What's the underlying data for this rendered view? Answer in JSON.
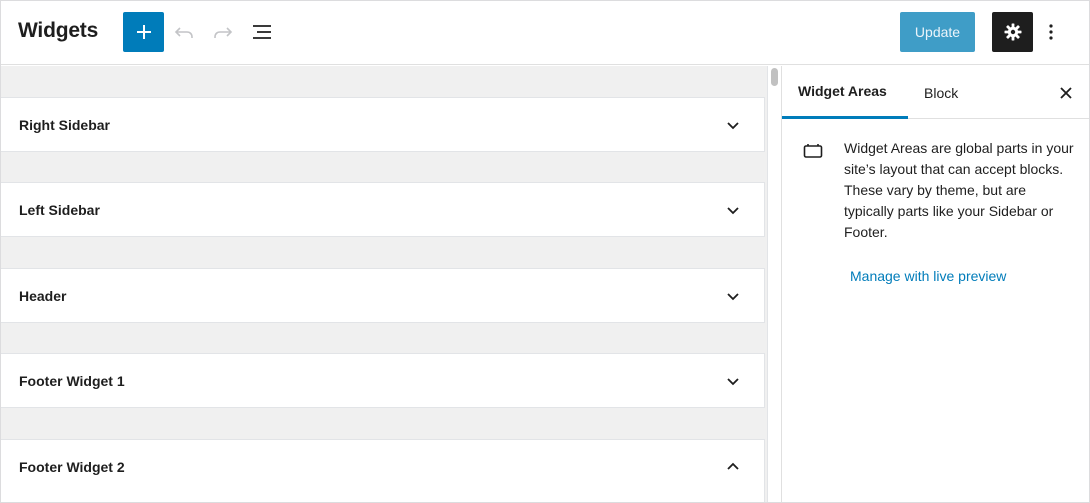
{
  "header": {
    "title": "Widgets",
    "update_label": "Update"
  },
  "widget_areas": [
    {
      "label": "Right Sidebar",
      "expanded": false
    },
    {
      "label": "Left Sidebar",
      "expanded": false
    },
    {
      "label": "Header",
      "expanded": false
    },
    {
      "label": "Footer Widget 1",
      "expanded": false
    },
    {
      "label": "Footer Widget 2",
      "expanded": true
    }
  ],
  "sidebar": {
    "tabs": [
      {
        "label": "Widget Areas",
        "active": true
      },
      {
        "label": "Block",
        "active": false
      }
    ],
    "description": "Widget Areas are global parts in your site’s layout that can accept blocks. These vary by theme, but are typically parts like your Sidebar or Footer.",
    "manage_link": "Manage with live preview"
  },
  "colors": {
    "accent": "#007cba",
    "dark_button": "#1e1e1e",
    "canvas_background": "#f0f0f0"
  },
  "icons": [
    "plus-icon",
    "undo-icon",
    "redo-icon",
    "list-view-icon",
    "gear-icon",
    "more-vertical-icon",
    "chevron-down-icon",
    "chevron-up-icon",
    "close-icon",
    "widget-area-icon"
  ]
}
